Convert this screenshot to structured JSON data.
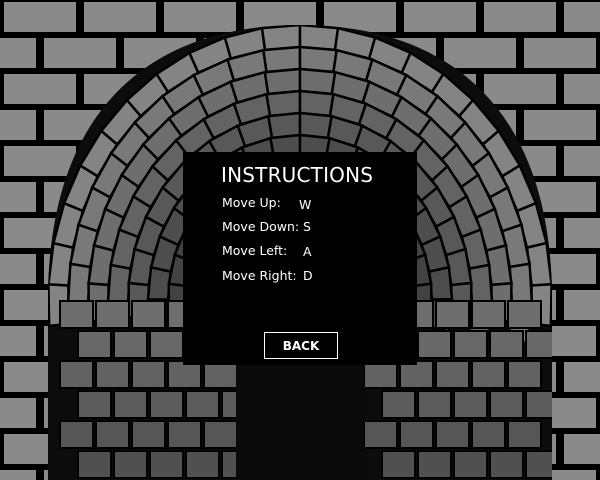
{
  "instructions": {
    "title": "INSTRUCTIONS",
    "controls": [
      {
        "action": "Move Up:",
        "key": "W"
      },
      {
        "action": "Move Down:",
        "key": "S"
      },
      {
        "action": "Move Left:",
        "key": "A"
      },
      {
        "action": "Move Right:",
        "key": "D"
      }
    ],
    "back_label": "BACK"
  },
  "colors": {
    "wall_brick": "#8a8a8a",
    "mortar": "#000000",
    "panel_background": "#000000",
    "text": "#ffffff"
  }
}
